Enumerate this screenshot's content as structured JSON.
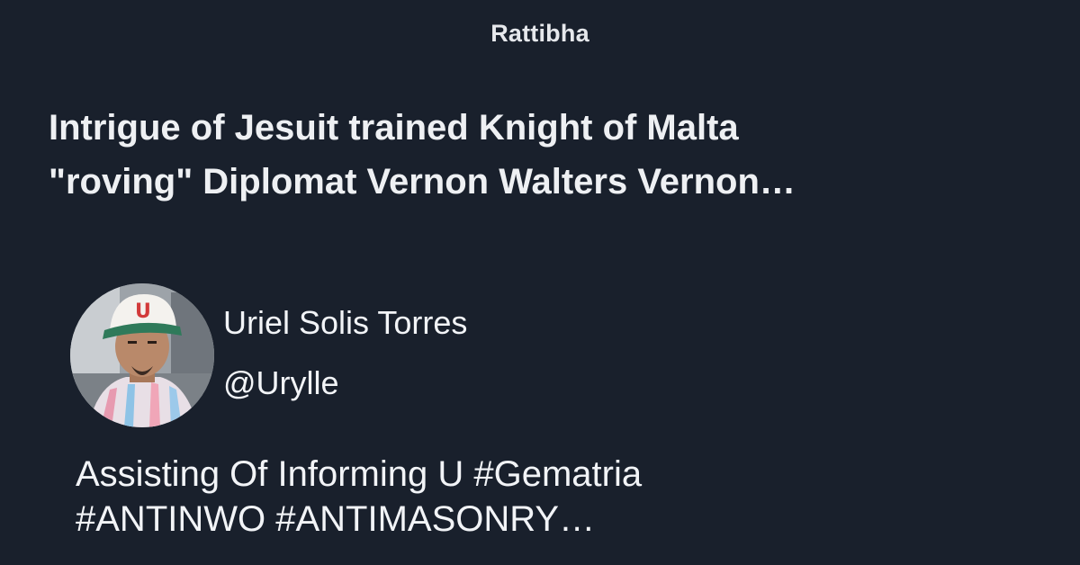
{
  "site": {
    "name": "Rattibha"
  },
  "thread": {
    "title_line1": "Intrigue of Jesuit trained Knight of Malta",
    "title_line2": "\"roving\" Diplomat Vernon Walters Vernon…"
  },
  "author": {
    "name": "Uriel Solis Torres",
    "handle": "@Urylle",
    "avatar_icon": "profile-photo",
    "cap_text": "U",
    "bio_line1": "Assisting Of Informing U #Gematria",
    "bio_line2": "#ANTINWO #ANTIMASONRY…"
  },
  "colors": {
    "background": "#19202c",
    "text": "#f2f4f7"
  }
}
